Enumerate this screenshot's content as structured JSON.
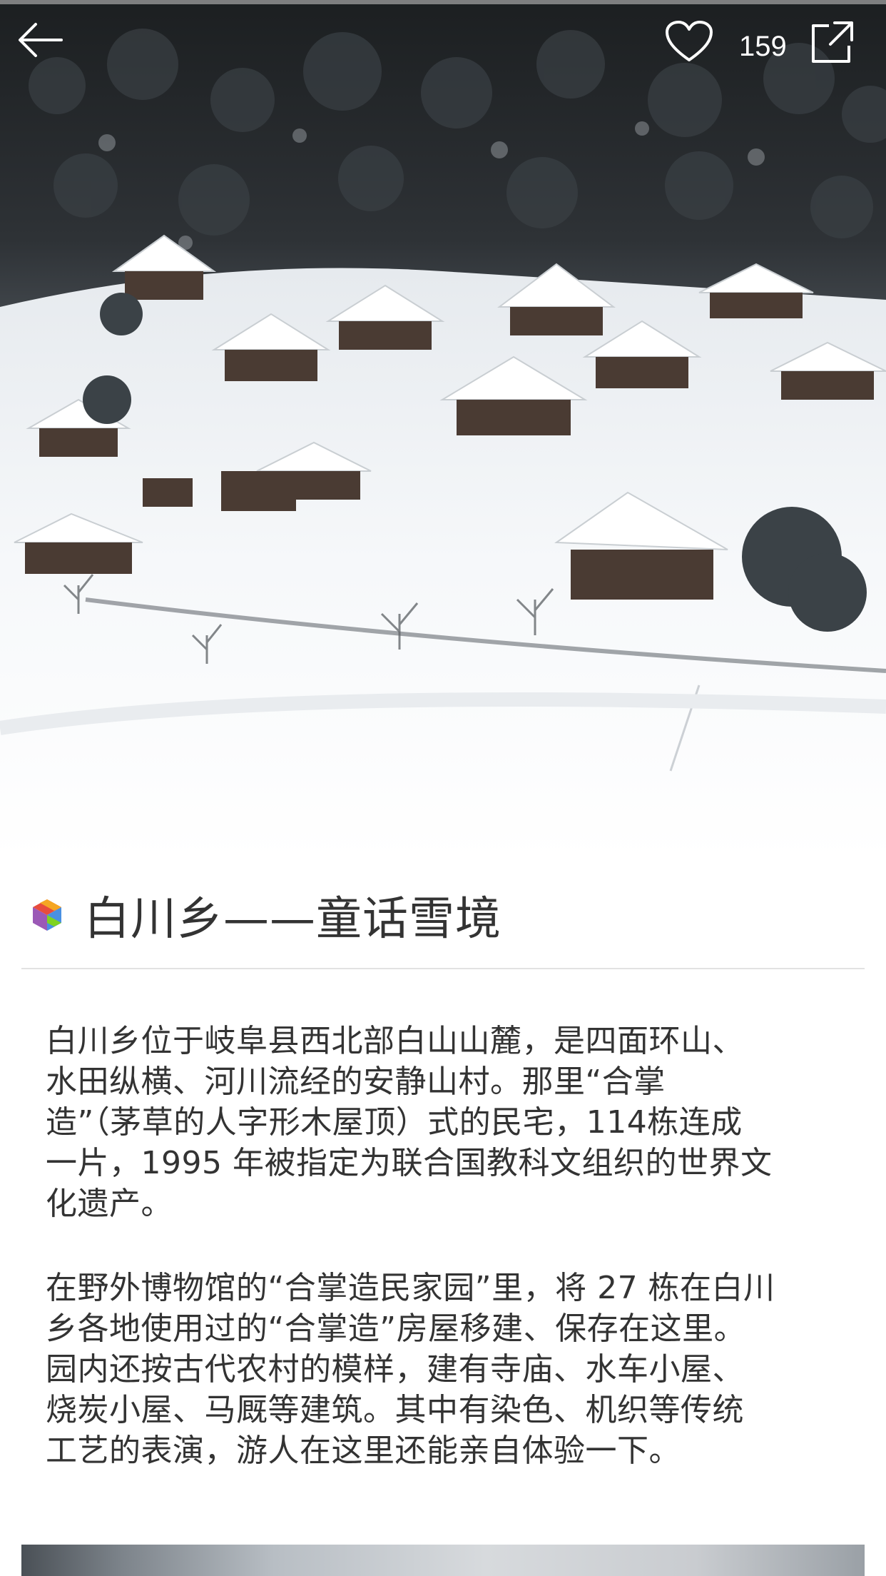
{
  "header": {
    "back_icon": "arrow-left-icon",
    "like_icon": "heart-outline-icon",
    "like_count": "159",
    "share_icon": "share-external-icon"
  },
  "hero": {
    "image": "snowy-village-photo"
  },
  "article": {
    "logo_icon": "colorful-cube-logo-icon",
    "title": "白川乡——童话雪境",
    "paragraphs": [
      "白川乡位于岐阜县西北部白山山麓，是四面环山、\n水田纵横、河川流经的安静山村。那里“合掌\n造”（茅草的人字形木屋顶）式的民宅，114栋连成\n一片，1995 年被指定为联合国教科文组织的世界文\n化遗产。",
      "在野外博物馆的“合掌造民家园”里，将 27 栋在白川\n乡各地使用过的“合掌造”房屋移建、保存在这里。\n园内还按古代农村的模样，建有寺庙、水车小屋、\n烧炭小屋、马厩等建筑。其中有染色、机织等传统\n工艺的表演，游人在这里还能亲自体验一下。"
    ]
  },
  "colors": {
    "text": "#333333",
    "divider": "#e2e2e2",
    "logo_colors": [
      "#f5a623",
      "#e84c3d",
      "#4a90e2",
      "#7ed321",
      "#9b59b6"
    ]
  }
}
